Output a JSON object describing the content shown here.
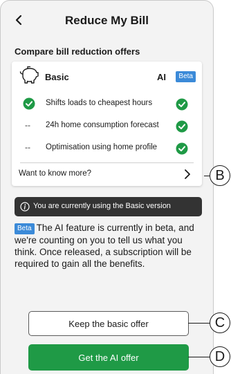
{
  "header": {
    "title": "Reduce My Bill"
  },
  "compare": {
    "title": "Compare bill reduction offers"
  },
  "card": {
    "plan_name": "Basic",
    "ai_label": "AI",
    "beta_badge": "Beta",
    "features": [
      {
        "label": "Shifts loads to cheapest hours",
        "basic_mark": "check-icon",
        "ai_mark": "check-icon"
      },
      {
        "label": "24h home consumption forecast",
        "basic_mark": "--",
        "ai_mark": "check-icon"
      },
      {
        "label": "Optimisation using home profile",
        "basic_mark": "--",
        "ai_mark": "check-icon"
      }
    ],
    "know_more": "Want to know more?"
  },
  "banner": {
    "text": "You are currently using the Basic version"
  },
  "beta_note": {
    "badge": "Beta",
    "text": "The AI feature is currently in beta, and we're counting on you to tell us what you think. Once released, a subscription will be required to gain all the benefits."
  },
  "buttons": {
    "keep_basic": "Keep the basic offer",
    "get_ai": "Get the AI offer"
  },
  "callouts": {
    "b": "B",
    "c": "C",
    "d": "D"
  },
  "colors": {
    "accent_green": "#1f9a46",
    "beta_blue": "#3b8ad8",
    "banner_bg": "#333333"
  }
}
